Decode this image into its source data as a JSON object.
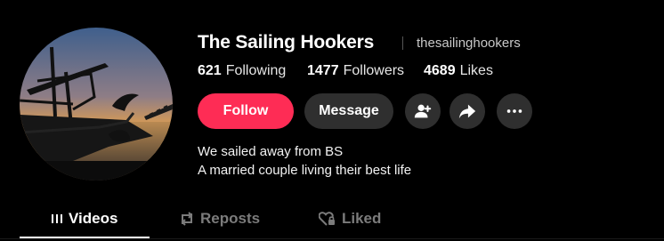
{
  "profile": {
    "display_name": "The Sailing Hookers",
    "handle": "thesailinghookers",
    "avatar_icon": "sailboat-sunset-avatar"
  },
  "stats": {
    "following_count": "621",
    "following_label": "Following",
    "followers_count": "1477",
    "followers_label": "Followers",
    "likes_count": "4689",
    "likes_label": "Likes"
  },
  "actions": {
    "follow_label": "Follow",
    "message_label": "Message",
    "add_friend_icon": "add-user-icon",
    "share_icon": "share-arrow-icon",
    "more_icon": "more-dots-icon"
  },
  "bio": {
    "line1": "We sailed away from BS",
    "line2": "A married couple living their best life"
  },
  "tabs": [
    {
      "label": "Videos",
      "icon": "grid-bars-icon",
      "active": true
    },
    {
      "label": "Reposts",
      "icon": "repost-icon",
      "active": false
    },
    {
      "label": "Liked",
      "icon": "heart-lock-icon",
      "active": false
    }
  ],
  "colors": {
    "background": "#000000",
    "follow_button": "#fe2c55",
    "secondary_button": "#2f2f2f",
    "inactive_tab": "#7b7b7b"
  }
}
